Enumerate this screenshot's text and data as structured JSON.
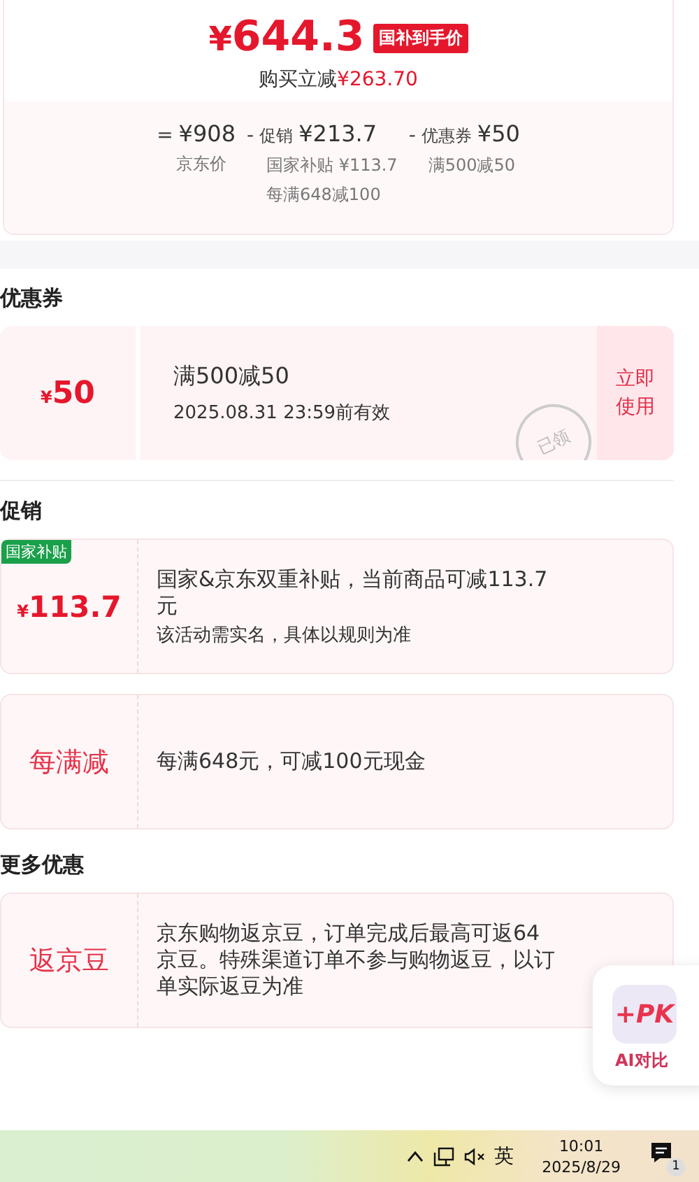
{
  "summary": {
    "currency": "¥",
    "price": "644.3",
    "price_tag": "国补到手价",
    "saving_label": "购买立减",
    "saving_amount": "¥263.70",
    "breakdown": [
      {
        "op": "=",
        "amount": "¥908",
        "notes": [
          "京东价"
        ]
      },
      {
        "op": "-",
        "label": "促销",
        "amount": "¥213.7",
        "notes": [
          "国家补贴 ¥113.7",
          "每满648减100"
        ]
      },
      {
        "op": "-",
        "label": "优惠券",
        "amount": "¥50",
        "notes": [
          "满500减50"
        ]
      }
    ]
  },
  "coupon_section": {
    "title": "优惠券",
    "coupons": [
      {
        "currency": "¥",
        "amount": "50",
        "condition": "满500减50",
        "validity": "2025.08.31 23:59前有效",
        "stamp": "已领",
        "action": "立即使用"
      }
    ]
  },
  "promotion_section": {
    "title": "促销",
    "items": [
      {
        "kind": "amount",
        "badge": "国家补贴",
        "currency": "¥",
        "amount": "113.7",
        "title": "国家&京东双重补贴，当前商品可减113.7元",
        "note": "该活动需实名，具体以规则为准"
      },
      {
        "kind": "label",
        "label": "每满减",
        "title": "每满648元，可减100元现金"
      }
    ]
  },
  "more_section": {
    "title": "更多优惠",
    "items": [
      {
        "kind": "label",
        "label": "返京豆",
        "title": "京东购物返京豆，订单完成后最高可返64京豆。特殊渠道订单不参与购物返豆，以订单实际返豆为准"
      }
    ]
  },
  "ai_widget": {
    "icon_text": "+PK",
    "label": "AI对比"
  },
  "taskbar": {
    "ime": "英",
    "time": "10:01",
    "date": "2025/8/29",
    "notification_count": "1"
  }
}
